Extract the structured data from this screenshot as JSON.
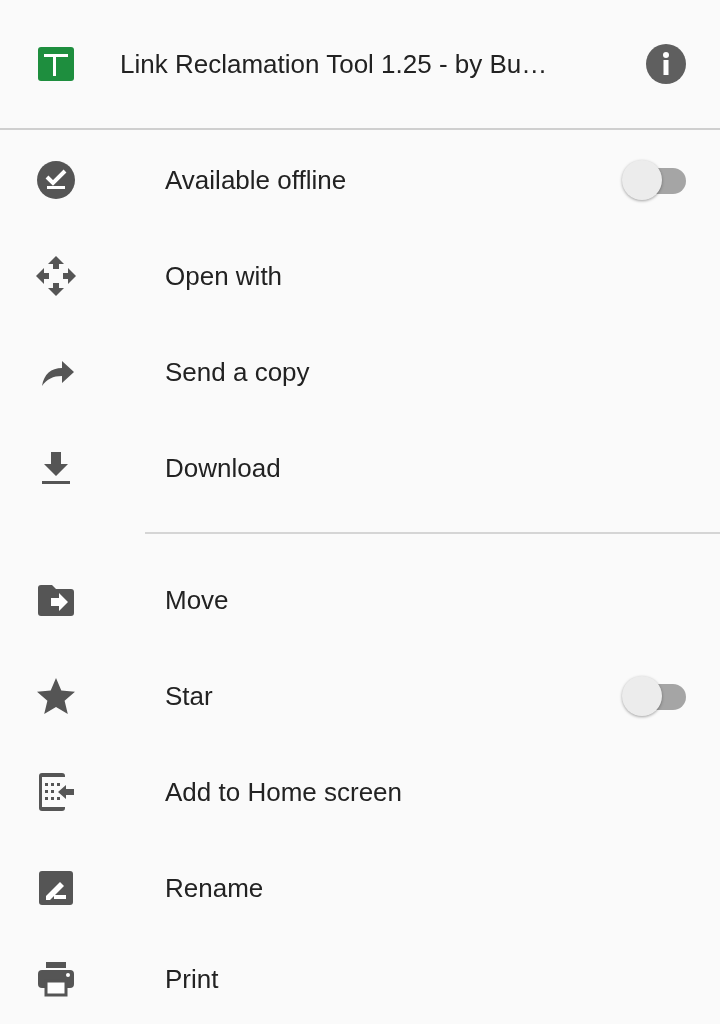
{
  "header": {
    "title": "Link Reclamation Tool 1.25 - by Bu…"
  },
  "sections": [
    {
      "items": [
        {
          "label": "Available offline",
          "kind": "toggle",
          "on": false
        },
        {
          "label": "Open with",
          "kind": "action"
        },
        {
          "label": "Send a copy",
          "kind": "action"
        },
        {
          "label": "Download",
          "kind": "action"
        }
      ]
    },
    {
      "items": [
        {
          "label": "Move",
          "kind": "action"
        },
        {
          "label": "Star",
          "kind": "toggle",
          "on": false
        },
        {
          "label": "Add to Home screen",
          "kind": "action"
        },
        {
          "label": "Rename",
          "kind": "action"
        },
        {
          "label": "Print",
          "kind": "action"
        }
      ]
    }
  ]
}
